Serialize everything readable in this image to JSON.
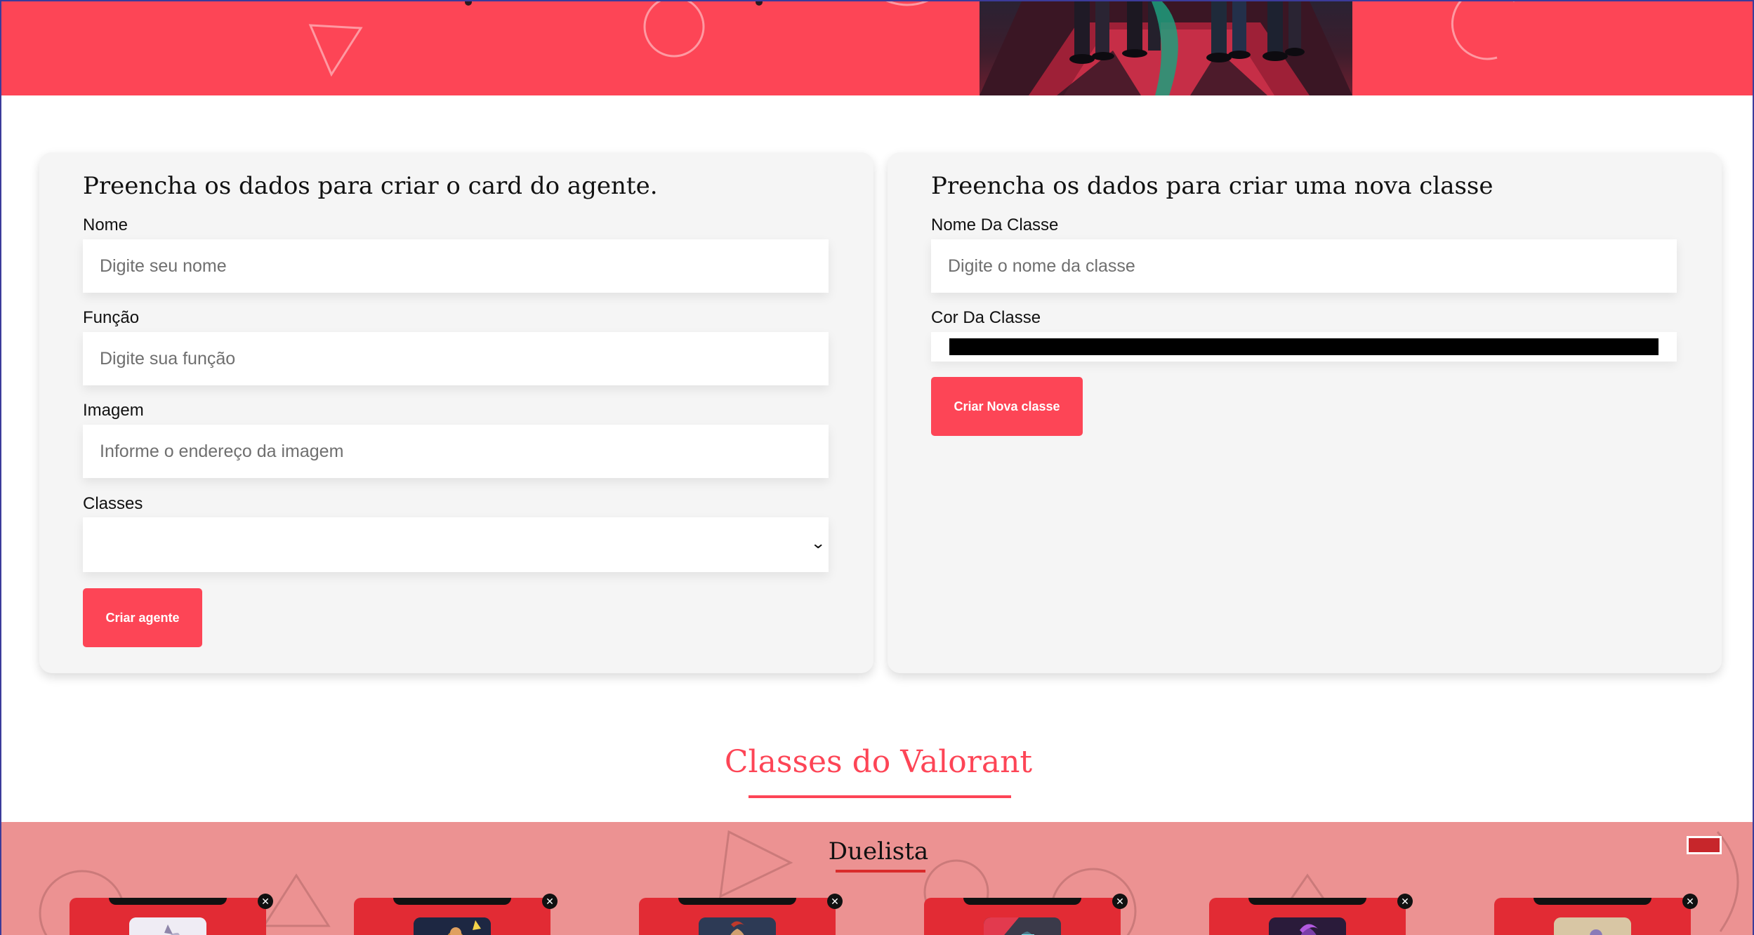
{
  "form_agent": {
    "title": "Preencha os dados para criar o card do agente.",
    "name_label": "Nome",
    "name_placeholder": "Digite seu nome",
    "role_label": "Função",
    "role_placeholder": "Digite sua função",
    "image_label": "Imagem",
    "image_placeholder": "Informe o endereço da imagem",
    "classes_label": "Classes",
    "classes_selected": "",
    "submit_label": "Criar agente"
  },
  "form_class": {
    "title": "Preencha os dados para criar uma nova classe",
    "name_label": "Nome Da Classe",
    "name_placeholder": "Digite o nome da classe",
    "color_label": "Cor Da Classe",
    "color_value": "#000000",
    "submit_label": "Criar Nova classe"
  },
  "section": {
    "title": "Classes do Valorant"
  },
  "class_band": {
    "name": "Duelista",
    "background_color": "#ec9292",
    "accent_color": "#d92b2b",
    "agents": [
      {
        "portrait_color": "#d9d4e8"
      },
      {
        "portrait_color": "#1d2742"
      },
      {
        "portrait_color": "#2d3a55"
      },
      {
        "portrait_color": "#3b3a4a"
      },
      {
        "portrait_color": "#2a1b3a"
      },
      {
        "portrait_color": "#c9b392"
      }
    ]
  },
  "colors": {
    "brand": "#fd4556",
    "card_bg": "#f5f5f5"
  }
}
